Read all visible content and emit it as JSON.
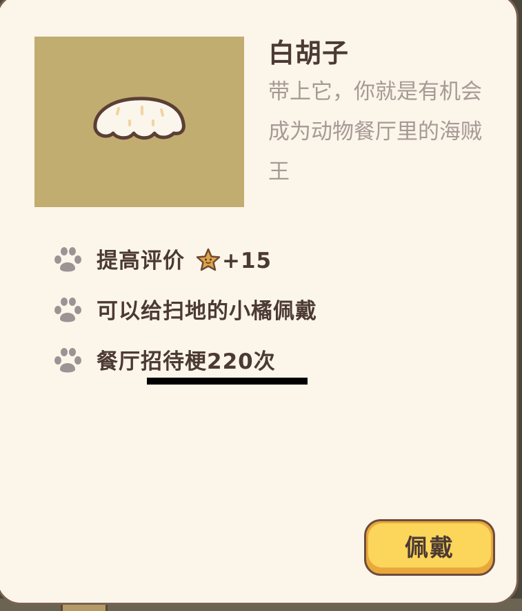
{
  "item": {
    "name": "白胡子",
    "description": "带上它，你就是有机会成为动物餐厅里的海贼王",
    "image_icon": "white-beard-icon"
  },
  "effects": [
    {
      "icon": "paw-icon",
      "text": "提高评价",
      "star_icon": "star-icon",
      "bonus": "+15"
    },
    {
      "icon": "paw-icon",
      "text": "可以给扫地的小橘佩戴"
    },
    {
      "icon": "paw-icon",
      "text": "餐厅招待梗220次"
    }
  ],
  "actions": {
    "wear_label": "佩戴"
  },
  "colors": {
    "card_bg": "#fcf5ea",
    "card_border": "#7a6150",
    "thumb_bg": "#c2ad70",
    "title_text": "#4b3a33",
    "desc_text": "#a69a95",
    "paw": "#9b9394",
    "button_face": "#fcd55b",
    "button_shadow": "#e9a83c",
    "star": "#e2a447"
  }
}
